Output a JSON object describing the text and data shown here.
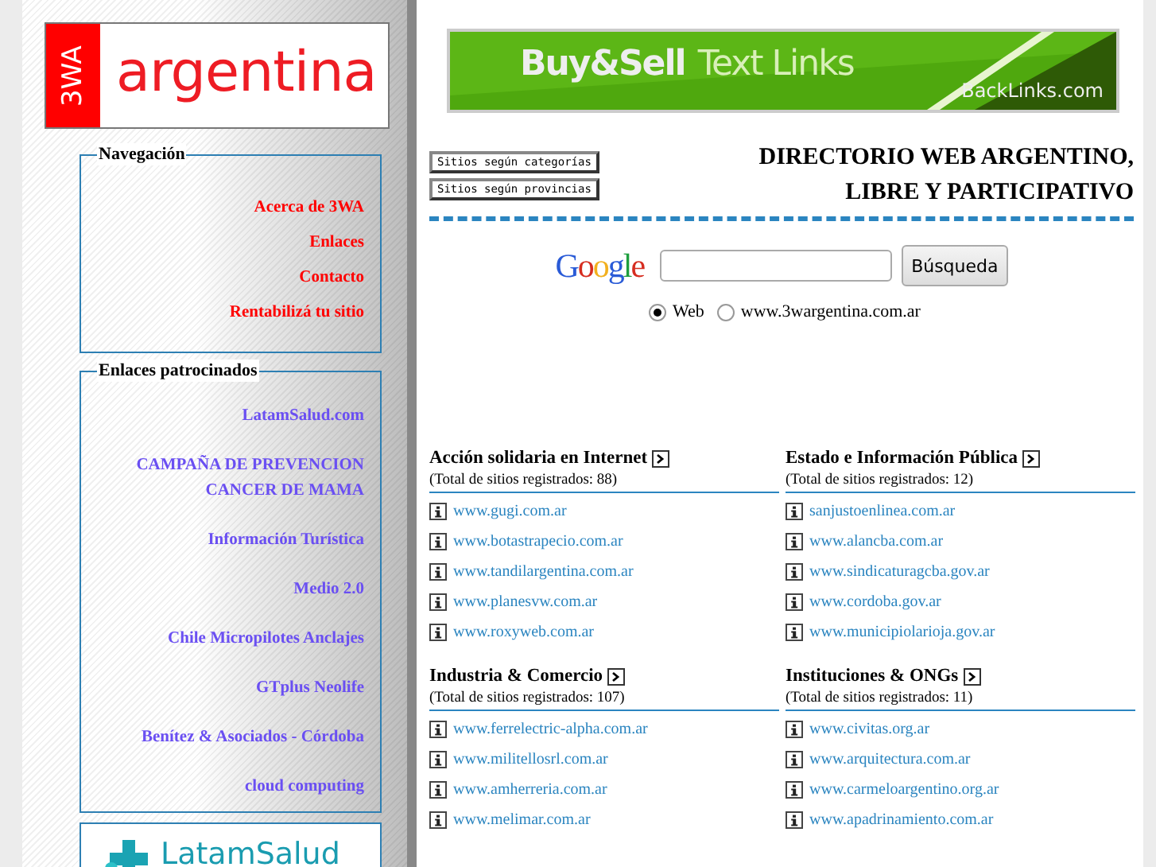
{
  "logo": {
    "badge": "3WA",
    "name": "argentina"
  },
  "navigation": {
    "title": "Navegación",
    "links": [
      "Acerca de 3WA",
      "Enlaces",
      "Contacto",
      "Rentabilizá tu sitio"
    ]
  },
  "sponsored": {
    "title": "Enlaces patrocinados",
    "links": [
      "LatamSalud.com",
      "CAMPAÑA DE PREVENCION CANCER DE MAMA",
      "Información Turística",
      "Medio 2.0",
      "Chile Micropilotes Anclajes",
      "GTplus Neolife",
      "Benítez & Asociados - Córdoba",
      "cloud computing"
    ]
  },
  "sponsor_banner": {
    "text": "LatamSalud"
  },
  "ad_banner": {
    "headline": "Buy&Sell",
    "subtitle": "Text Links",
    "site": "BackLinks.com"
  },
  "directory_buttons": [
    "Sitios según categorías",
    "Sitios según provincias"
  ],
  "tagline": [
    "DIRECTORIO WEB ARGENTINO,",
    "LIBRE Y PARTICIPATIVO"
  ],
  "search": {
    "logo": "Google",
    "button": "Búsqueda",
    "options": [
      {
        "label": "Web",
        "selected": true
      },
      {
        "label": "www.3wargentina.com.ar",
        "selected": false
      }
    ]
  },
  "categories": [
    {
      "title": "Acción solidaria en Internet",
      "total": "(Total de sitios registrados: 88)",
      "sites": [
        "www.gugi.com.ar",
        "www.botastrapecio.com.ar",
        "www.tandilargentina.com.ar",
        "www.planesvw.com.ar",
        "www.roxyweb.com.ar"
      ]
    },
    {
      "title": "Estado e Información Pública",
      "total": "(Total de sitios registrados: 12)",
      "sites": [
        "sanjustoenlinea.com.ar",
        "www.alancba.com.ar",
        "www.sindicaturagcba.gov.ar",
        "www.cordoba.gov.ar",
        "www.municipiolarioja.gov.ar"
      ]
    },
    {
      "title": "Industria & Comercio",
      "total": "(Total de sitios registrados: 107)",
      "sites": [
        "www.ferrelectric-alpha.com.ar",
        "www.militellosrl.com.ar",
        "www.amherreria.com.ar",
        "www.melimar.com.ar"
      ]
    },
    {
      "title": "Instituciones & ONGs",
      "total": "(Total de sitios registrados: 11)",
      "sites": [
        "www.civitas.org.ar",
        "www.arquitectura.com.ar",
        "www.carmeloargentino.org.ar",
        "www.apadrinamiento.com.ar"
      ]
    }
  ]
}
